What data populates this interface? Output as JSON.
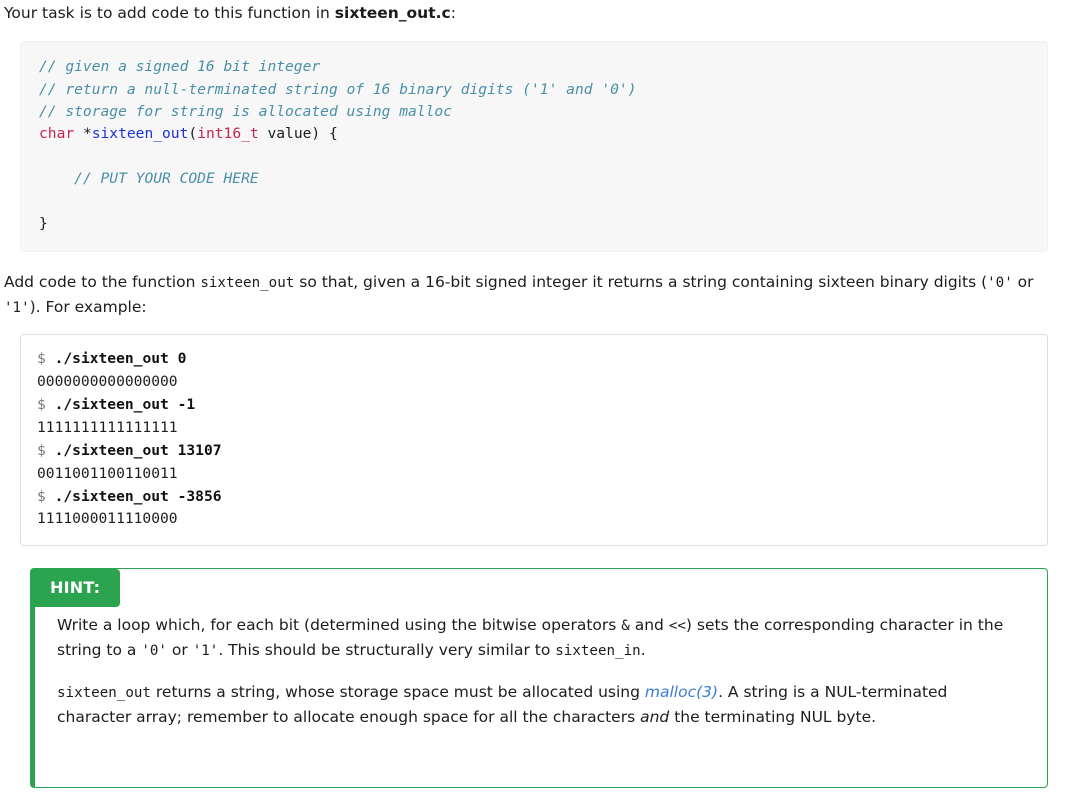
{
  "intro": {
    "prefix": "Your task is to add code to this function in ",
    "filename": "sixteen_out.c",
    "suffix": ":"
  },
  "code_block": {
    "language": "c",
    "lines": [
      "// given a signed 16 bit integer",
      "// return a null-terminated string of 16 binary digits ('1' and '0')",
      "// storage for string is allocated using malloc",
      "char *sixteen_out(int16_t value) {",
      "",
      "    // PUT YOUR CODE HERE",
      "",
      "}"
    ],
    "tokens": {
      "comment1": "// given a signed 16 bit integer",
      "comment2": "// return a null-terminated string of 16 binary digits ('1' and '0')",
      "comment3": "// storage for string is allocated using malloc",
      "kw_char": "char",
      "star": " *",
      "fn_name": "sixteen_out",
      "paren_open": "(",
      "type_int16": "int16_t",
      "param": " value) {",
      "comment_put": "// PUT YOUR CODE HERE",
      "brace_close": "}"
    },
    "colors": {
      "background": "#f7f7f7",
      "comment": "#4a8fa8",
      "keyword": "#c7254e",
      "function": "#1a31d6",
      "text": "#1c1c1c"
    }
  },
  "paragraph": {
    "part1": "Add code to the function ",
    "code1": "sixteen_out",
    "part2": " so that, given a 16-bit signed integer it returns a string containing sixteen binary digits (",
    "code2": "'0'",
    "part3": " or ",
    "code3": "'1'",
    "part4": "). For example:"
  },
  "terminal": {
    "entries": [
      {
        "prompt": "$",
        "command": "./sixteen_out 0",
        "output": "0000000000000000"
      },
      {
        "prompt": "$",
        "command": "./sixteen_out -1",
        "output": "1111111111111111"
      },
      {
        "prompt": "$",
        "command": "./sixteen_out 13107",
        "output": "0011001100110011"
      },
      {
        "prompt": "$",
        "command": "./sixteen_out -3856",
        "output": "1111000011110000"
      }
    ]
  },
  "hint": {
    "label": "HINT:",
    "accent_color": "#2aa44f",
    "paragraph1": {
      "part1": "Write a loop which, for each bit (determined using the bitwise operators ",
      "code1": "&",
      "part2": " and ",
      "code2": "<<",
      "part3": ") sets the corresponding character in the string to a ",
      "code3": "'0'",
      "part4": " or ",
      "code4": "'1'",
      "part5": ". This should be structurally very similar to ",
      "code5": "sixteen_in",
      "part6": "."
    },
    "paragraph2": {
      "code1": "sixteen_out",
      "part1": " returns a string, whose storage space must be allocated using ",
      "link": "malloc(3)",
      "link_color": "#3a7bd5",
      "part2": ". A string is a NUL-terminated character array; remember to allocate enough space for all the characters ",
      "emphasis": "and",
      "part3": " the terminating NUL byte."
    }
  }
}
